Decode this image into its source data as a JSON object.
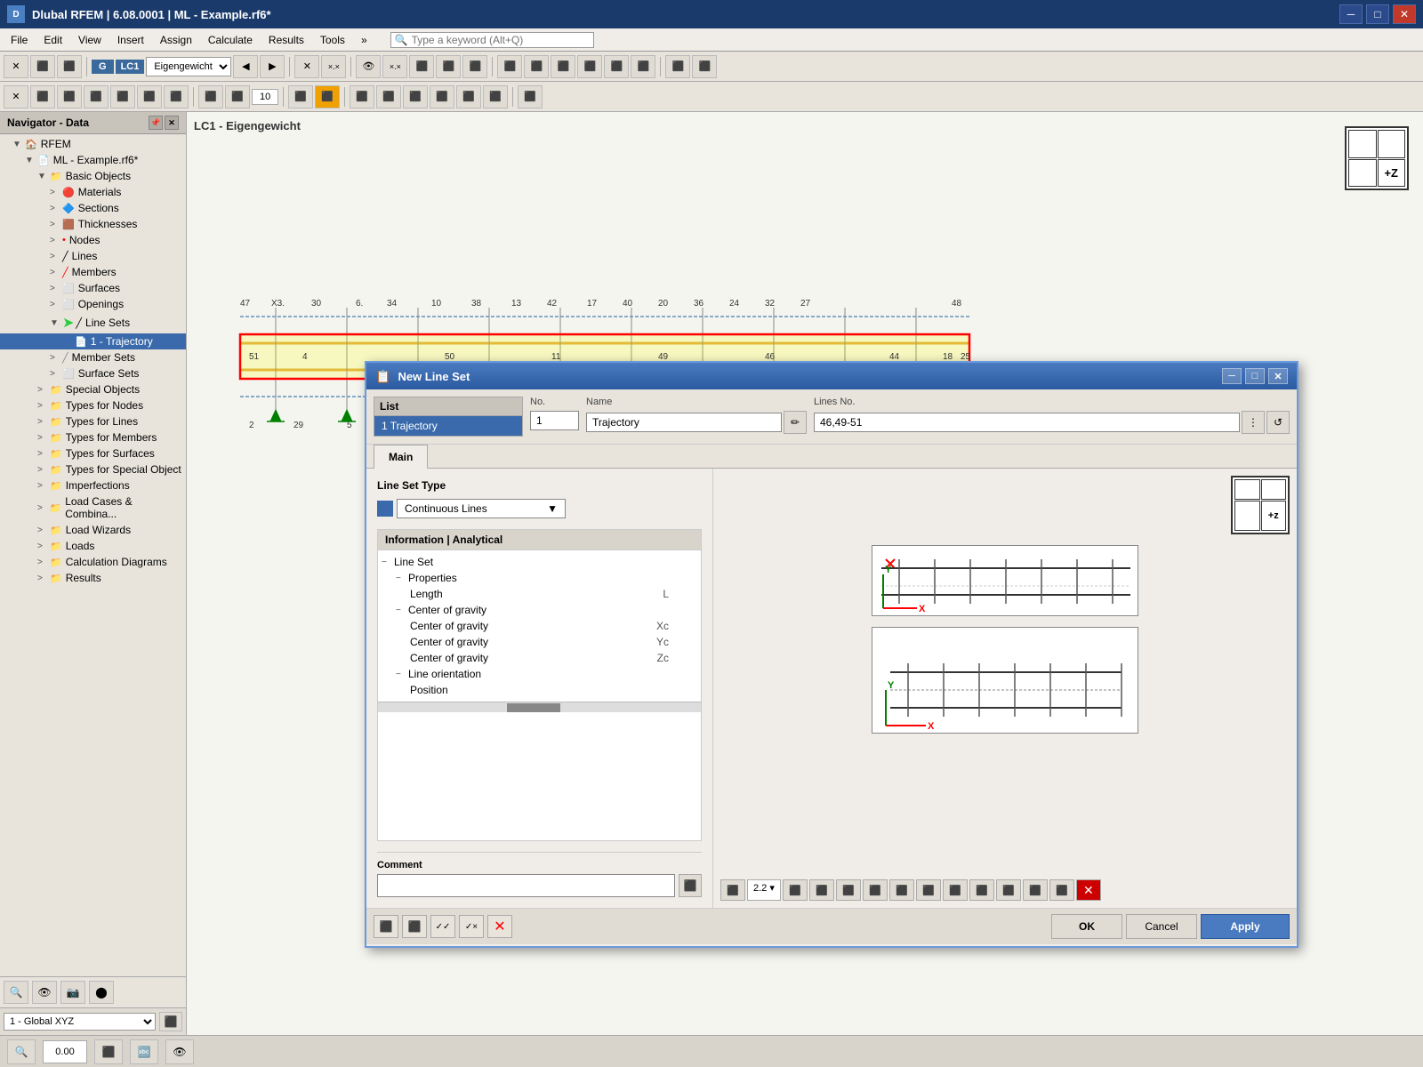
{
  "app": {
    "title": "Dlubal RFEM | 6.08.0001 | ML - Example.rf6*",
    "icon": "D"
  },
  "title_bar": {
    "minimize": "─",
    "maximize": "□",
    "close": "✕"
  },
  "menu": {
    "items": [
      "File",
      "Edit",
      "View",
      "Insert",
      "Assign",
      "Calculate",
      "Results",
      "Tools"
    ],
    "search_placeholder": "Type a keyword (Alt+Q)"
  },
  "toolbar1": {
    "lc_label": "LC1",
    "lc_name": "Eigengewicht"
  },
  "navigator": {
    "title": "Navigator - Data",
    "root": "RFEM",
    "file": "ML - Example.rf6*",
    "tree": [
      {
        "label": "Basic Objects",
        "indent": 2,
        "type": "folder",
        "expanded": true
      },
      {
        "label": "Materials",
        "indent": 3,
        "type": "material"
      },
      {
        "label": "Sections",
        "indent": 3,
        "type": "section"
      },
      {
        "label": "Thicknesses",
        "indent": 3,
        "type": "thickness"
      },
      {
        "label": "Nodes",
        "indent": 3,
        "type": "node"
      },
      {
        "label": "Lines",
        "indent": 3,
        "type": "line"
      },
      {
        "label": "Members",
        "indent": 3,
        "type": "member"
      },
      {
        "label": "Surfaces",
        "indent": 3,
        "type": "surface"
      },
      {
        "label": "Openings",
        "indent": 3,
        "type": "opening"
      },
      {
        "label": "Line Sets",
        "indent": 3,
        "type": "lineset",
        "arrow": true
      },
      {
        "label": "1 - Trajectory",
        "indent": 4,
        "type": "trajectory",
        "selected": true
      },
      {
        "label": "Member Sets",
        "indent": 3,
        "type": "memberset"
      },
      {
        "label": "Surface Sets",
        "indent": 3,
        "type": "surfaceset"
      },
      {
        "label": "Special Objects",
        "indent": 2,
        "type": "folder"
      },
      {
        "label": "Types for Nodes",
        "indent": 2,
        "type": "folder"
      },
      {
        "label": "Types for Lines",
        "indent": 2,
        "type": "folder"
      },
      {
        "label": "Types for Members",
        "indent": 2,
        "type": "folder"
      },
      {
        "label": "Types for Surfaces",
        "indent": 2,
        "type": "folder"
      },
      {
        "label": "Types for Special Object",
        "indent": 2,
        "type": "folder"
      },
      {
        "label": "Imperfections",
        "indent": 2,
        "type": "folder"
      },
      {
        "label": "Load Cases & Combina...",
        "indent": 2,
        "type": "folder"
      },
      {
        "label": "Load Wizards",
        "indent": 2,
        "type": "folder"
      },
      {
        "label": "Loads",
        "indent": 2,
        "type": "folder"
      },
      {
        "label": "Calculation Diagrams",
        "indent": 2,
        "type": "folder"
      },
      {
        "label": "Results",
        "indent": 2,
        "type": "folder"
      }
    ]
  },
  "drawing": {
    "title": "LC1 - Eigengewicht"
  },
  "dialog": {
    "title": "New Line Set",
    "list_header": "List",
    "list_item": "1 Trajectory",
    "no_label": "No.",
    "no_value": "1",
    "name_label": "Name",
    "name_value": "Trajectory",
    "lines_no_label": "Lines No.",
    "lines_no_value": "46,49-51",
    "tab_main": "Main",
    "lineset_type_label": "Line Set Type",
    "lineset_type_value": "Continuous Lines",
    "info_header": "Information | Analytical",
    "info_tree": [
      {
        "label": "Line Set",
        "indent": 0,
        "expandable": true
      },
      {
        "label": "Properties",
        "indent": 1,
        "expandable": true
      },
      {
        "label": "Length",
        "indent": 2,
        "value": "L"
      },
      {
        "label": "Center of gravity",
        "indent": 1,
        "expandable": true
      },
      {
        "label": "Center of gravity",
        "indent": 2,
        "value": "Xc"
      },
      {
        "label": "Center of gravity",
        "indent": 2,
        "value": "Yc"
      },
      {
        "label": "Center of gravity",
        "indent": 2,
        "value": "Zc"
      },
      {
        "label": "Line orientation",
        "indent": 1,
        "expandable": true
      },
      {
        "label": "Position",
        "indent": 2,
        "value": ""
      }
    ],
    "comment_label": "Comment",
    "comment_placeholder": "",
    "buttons": {
      "ok": "OK",
      "cancel": "Cancel",
      "apply": "Apply"
    }
  },
  "bottom_bar": {
    "ok": "OK",
    "cancel": "Cancel",
    "apply": "Apply"
  },
  "status": {
    "coord": "1 - Global XYZ"
  }
}
